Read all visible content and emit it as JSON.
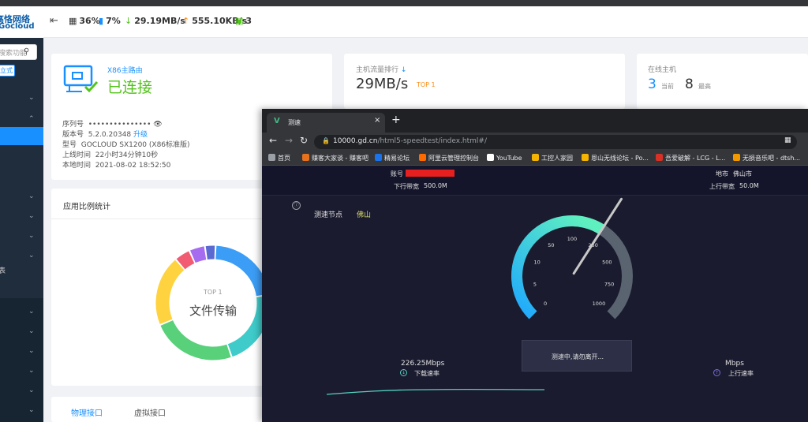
{
  "brand": {
    "line1": "高恪网络",
    "line2": "Gocloud"
  },
  "sidebar": {
    "search_placeholder": "搜索功能",
    "mode_label": "立式",
    "item_text": "表"
  },
  "header": {
    "cpu": "36%",
    "mem": "7%",
    "download": "29.19MB/s",
    "upload": "555.10KB/s",
    "devices": "3"
  },
  "router_card": {
    "name": "X86主路由",
    "status": "已连接",
    "serial_label": "序列号",
    "serial_value": "•••••••••••••••",
    "version_label": "版本号",
    "version_value": "5.2.0.20348",
    "upgrade": "升级",
    "model_label": "型号",
    "model_value": "GOCLOUD SX1200 (X86标准版)",
    "uptime_label": "上线时间",
    "uptime_value": "22小时34分钟10秒",
    "time_label": "本地时间",
    "time_value": "2021-08-02 18:52:50"
  },
  "traffic_card": {
    "title": "主机流量排行",
    "value": "29MB/s",
    "badge": "TOP 1"
  },
  "hosts_card": {
    "title": "在线主机",
    "current": "3",
    "current_label": "当前",
    "max": "8",
    "max_label": "最高"
  },
  "ratio_card": {
    "title": "应用比例统计",
    "center_top": "TOP 1",
    "center_label": "文件传输"
  },
  "iface_card": {
    "tab_physical": "物理接口",
    "tab_virtual": "虚拟接口"
  },
  "donut": [
    {
      "value": 22,
      "color": "#3b9df5"
    },
    {
      "value": 22,
      "color": "#3ecbc9"
    },
    {
      "value": 24,
      "color": "#59d07a"
    },
    {
      "value": 20,
      "color": "#ffd23f"
    },
    {
      "value": 4.5,
      "color": "#f25c72"
    },
    {
      "value": 4.5,
      "color": "#a56cf0"
    },
    {
      "value": 3,
      "color": "#5b6ad0"
    }
  ],
  "browser": {
    "tab_title": "测速",
    "url_host": "10000.gd.cn",
    "url_path": "/html5-speedtest/index.html#/",
    "bookmarks": [
      {
        "label": "首页",
        "color": "#9aa0a6"
      },
      {
        "label": "赚客大家谈 - 赚客吧",
        "color": "#e8711c"
      },
      {
        "label": "精易论坛",
        "color": "#1a73e8"
      },
      {
        "label": "阿里云管理控制台",
        "color": "#ff6a00"
      },
      {
        "label": "YouTube",
        "color": "#ffffff"
      },
      {
        "label": "工控人家园",
        "color": "#f4b400"
      },
      {
        "label": "恩山无线论坛 - Po...",
        "color": "#f4b400"
      },
      {
        "label": "吾爱破解 - LCG - L...",
        "color": "#d93025"
      },
      {
        "label": "无损音乐吧 - dtsh...",
        "color": "#f29900"
      }
    ]
  },
  "speedtest": {
    "account_label": "账号",
    "down_bw_label": "下行带宽",
    "down_bw": "500.0M",
    "city_label": "地市",
    "city": "佛山市",
    "up_bw_label": "上行带宽",
    "up_bw": "50.0M",
    "node_label": "测速节点",
    "node": "佛山",
    "gauge_ticks": [
      "0",
      "5",
      "10",
      "50",
      "100",
      "250",
      "500",
      "750",
      "1000"
    ],
    "status": "测速中,请勿离开...",
    "download_value": "226.25Mbps",
    "download_label": "下载速率",
    "upload_value": "Mbps",
    "upload_label": "上行速率",
    "needle_value": 250
  }
}
